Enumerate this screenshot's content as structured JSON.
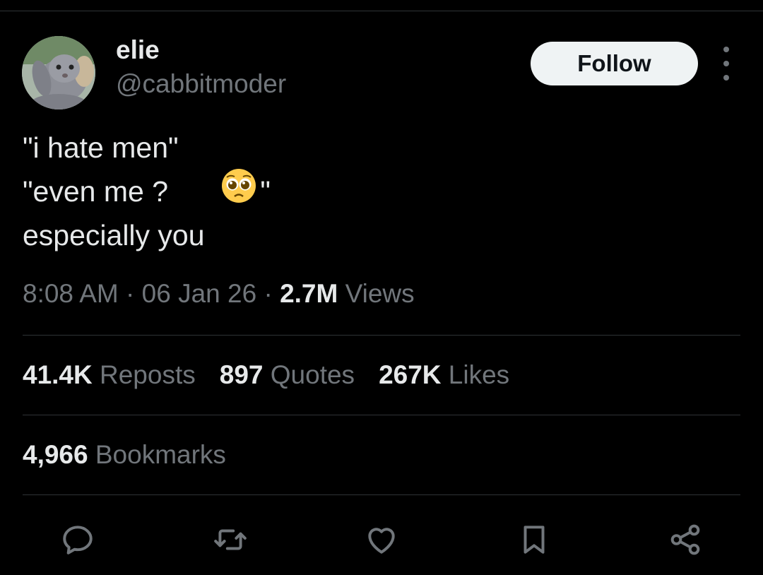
{
  "author": {
    "name": "elie",
    "handle": "@cabbitmoder"
  },
  "follow_label": "Follow",
  "tweet": {
    "lines": [
      "\"i hate men\"",
      "\"even me ?",
      "\"",
      "especially you"
    ],
    "emoji": "pleading-face-emoji"
  },
  "meta": {
    "time": "8:08 AM",
    "sep1": " · ",
    "date": "06 Jan 26",
    "sep2": " · ",
    "views_count": "2.7M",
    "views_label": " Views"
  },
  "stats": {
    "reposts_count": "41.4K",
    "reposts_label": " Reposts",
    "quotes_count": "897",
    "quotes_label": " Quotes",
    "likes_count": "267K",
    "likes_label": " Likes",
    "bookmarks_count": "4,966",
    "bookmarks_label": " Bookmarks"
  },
  "actions": [
    "reply-icon",
    "repost-icon",
    "like-icon",
    "bookmark-icon",
    "share-icon"
  ],
  "colors": {
    "background": "#000000",
    "text_primary": "#e7e9ea",
    "text_secondary": "#71767b",
    "divider": "#2f3336",
    "follow_bg": "#eff3f4"
  }
}
